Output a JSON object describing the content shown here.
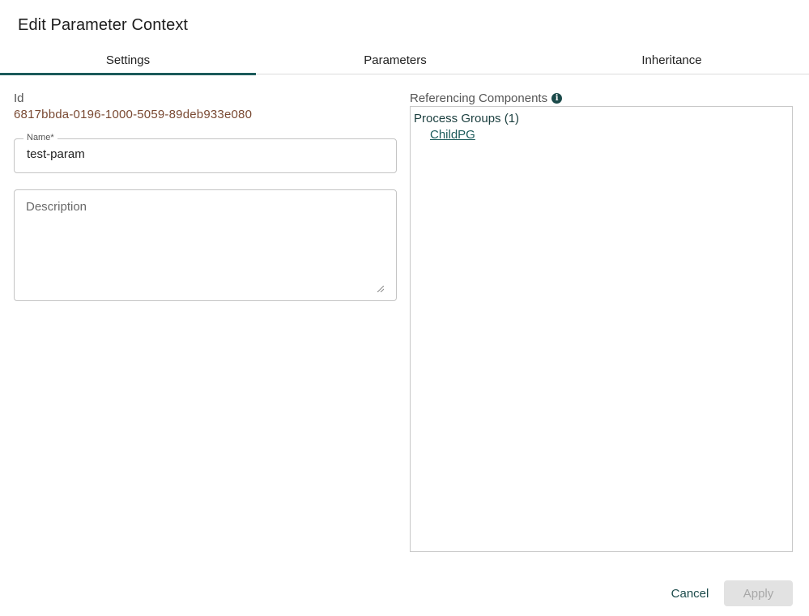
{
  "dialog": {
    "title": "Edit Parameter Context"
  },
  "tabs": [
    {
      "label": "Settings",
      "active": true
    },
    {
      "label": "Parameters",
      "active": false
    },
    {
      "label": "Inheritance",
      "active": false
    }
  ],
  "settings": {
    "id_label": "Id",
    "id_value": "6817bbda-0196-1000-5059-89deb933e080",
    "name_label": "Name*",
    "name_value": "test-param",
    "description_placeholder": "Description",
    "description_value": ""
  },
  "referencing": {
    "label": "Referencing Components",
    "info_icon": "info-circle-icon",
    "groups": [
      {
        "title": "Process Groups (1)",
        "items": [
          "ChildPG"
        ]
      }
    ]
  },
  "footer": {
    "cancel_label": "Cancel",
    "apply_label": "Apply",
    "apply_disabled": true
  },
  "colors": {
    "accent": "#1b5a5a",
    "id_value": "#7a4a33",
    "disabled_bg": "#e2e2e2"
  }
}
